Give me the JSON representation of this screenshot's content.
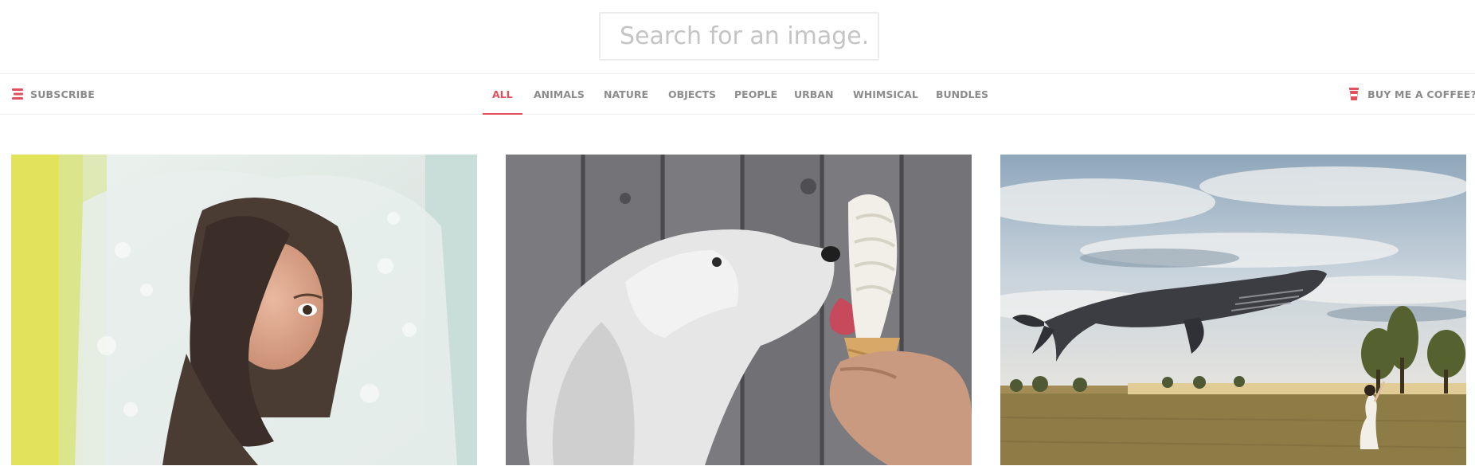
{
  "search": {
    "placeholder": "Search for an image."
  },
  "nav": {
    "subscribe_label": "SUBSCRIBE",
    "coffee_label": "BUY ME A COFFEE?",
    "categories": [
      {
        "label": "ALL",
        "active": true
      },
      {
        "label": "ANIMALS",
        "active": false
      },
      {
        "label": "NATURE",
        "active": false
      },
      {
        "label": "OBJECTS",
        "active": false
      },
      {
        "label": "PEOPLE",
        "active": false
      },
      {
        "label": "URBAN",
        "active": false
      },
      {
        "label": "WHIMSICAL",
        "active": false
      },
      {
        "label": "BUNDLES",
        "active": false
      }
    ]
  },
  "colors": {
    "accent": "#e2505e",
    "nav_text": "#8c8c8c",
    "border": "#eeeeee"
  },
  "icons": {
    "subscribe": "stack-icon",
    "coffee": "coffee-cup-icon"
  },
  "gallery": [
    {
      "subject": "woman-in-bubble-wrap"
    },
    {
      "subject": "dog-licking-ice-cream"
    },
    {
      "subject": "whale-flying-over-field"
    }
  ]
}
